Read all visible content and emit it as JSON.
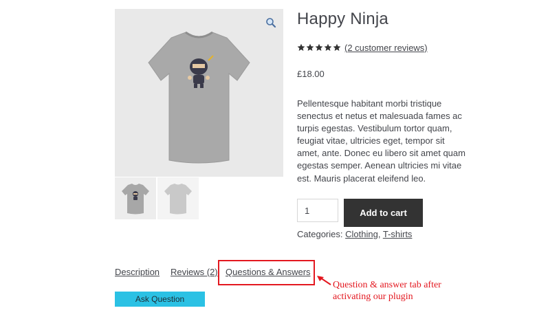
{
  "product": {
    "title": "Happy Ninja",
    "rating_value": 5,
    "rating_max": 5,
    "reviews_link": "(2 customer reviews)",
    "price": "£18.00",
    "description": "Pellentesque habitant morbi tristique senectus et netus et malesuada fames ac turpis egestas. Vestibulum tortor quam, feugiat vitae, ultricies eget, tempor sit amet, ante. Donec eu libero sit amet quam egestas semper. Aenean ultricies mi vitae est. Mauris placerat eleifend leo.",
    "quantity": "1",
    "add_to_cart": "Add to cart",
    "categories_label": "Categories:",
    "categories": [
      "Clothing",
      "T-shirts"
    ],
    "category_separator": ", "
  },
  "tabs": [
    {
      "label": "Description"
    },
    {
      "label": "Reviews (2)"
    },
    {
      "label": "Questions & Answers"
    }
  ],
  "ask_button": "Ask Question",
  "annotation": {
    "line1": "Question & answer tab after",
    "line2": "activating our plugin",
    "color": "#e3171f"
  },
  "colors": {
    "text": "#43454b",
    "button_dark": "#333333",
    "ask_button": "#2bc1e4",
    "star": "#333333"
  },
  "icons": {
    "zoom": "magnifier-icon",
    "star": "star-icon"
  }
}
